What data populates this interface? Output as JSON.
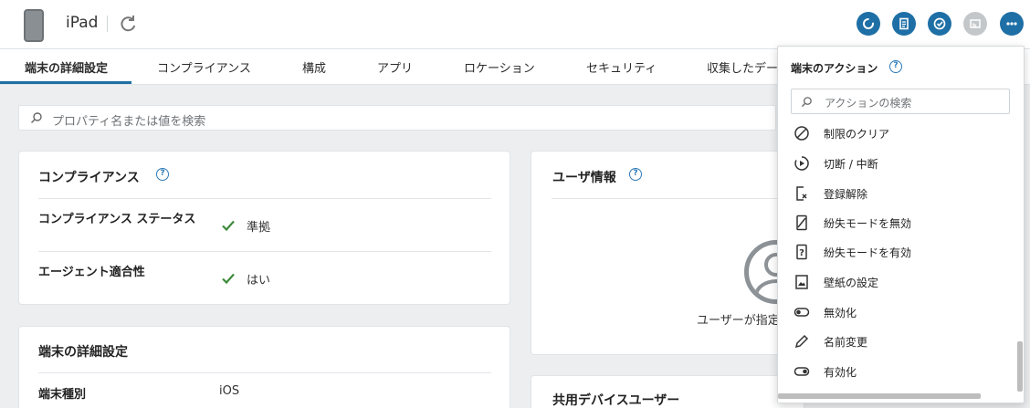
{
  "header": {
    "device_name": "iPad",
    "actions": [
      {
        "icon": "sync-icon"
      },
      {
        "icon": "document-icon"
      },
      {
        "icon": "check-circle-icon"
      },
      {
        "icon": "cast-icon",
        "disabled": true
      },
      {
        "icon": "more-icon"
      }
    ]
  },
  "tabs": [
    {
      "label": "端末の詳細設定",
      "active": true
    },
    {
      "label": "コンプライアンス"
    },
    {
      "label": "構成"
    },
    {
      "label": "アプリ"
    },
    {
      "label": "ロケーション"
    },
    {
      "label": "セキュリティ"
    },
    {
      "label": "収集したデー"
    }
  ],
  "search": {
    "placeholder": "プロパティ名または値を検索"
  },
  "compliance_card": {
    "title": "コンプライアンス",
    "rows": [
      {
        "label": "コンプライアンス ステータス",
        "value": "準拠"
      },
      {
        "label": "エージェント適合性",
        "value": "はい"
      }
    ]
  },
  "device_details_card": {
    "title": "端末の詳細設定",
    "rows": [
      {
        "label": "端末種別",
        "value": "iOS"
      }
    ]
  },
  "user_card": {
    "title": "ユーザ情報",
    "message": "ユーザーが指定"
  },
  "shared_card": {
    "title": "共用デバイスユーザー"
  },
  "dropdown": {
    "title": "端末のアクション",
    "search_placeholder": "アクションの検索",
    "items": [
      {
        "label": "制限のクリア",
        "icon": "clear-restriction-icon"
      },
      {
        "label": "切断 / 中断",
        "icon": "disconnect-icon"
      },
      {
        "label": "登録解除",
        "icon": "unenroll-icon"
      },
      {
        "label": "紛失モードを無効",
        "icon": "lost-mode-off-icon"
      },
      {
        "label": "紛失モードを有効",
        "icon": "lost-mode-on-icon"
      },
      {
        "label": "壁紙の設定",
        "icon": "wallpaper-icon"
      },
      {
        "label": "無効化",
        "icon": "toggle-off-icon"
      },
      {
        "label": "名前変更",
        "icon": "pencil-icon"
      },
      {
        "label": "有効化",
        "icon": "toggle-on-icon"
      }
    ]
  },
  "colors": {
    "accent": "#1e6fa6",
    "check": "#3b8a3b"
  }
}
